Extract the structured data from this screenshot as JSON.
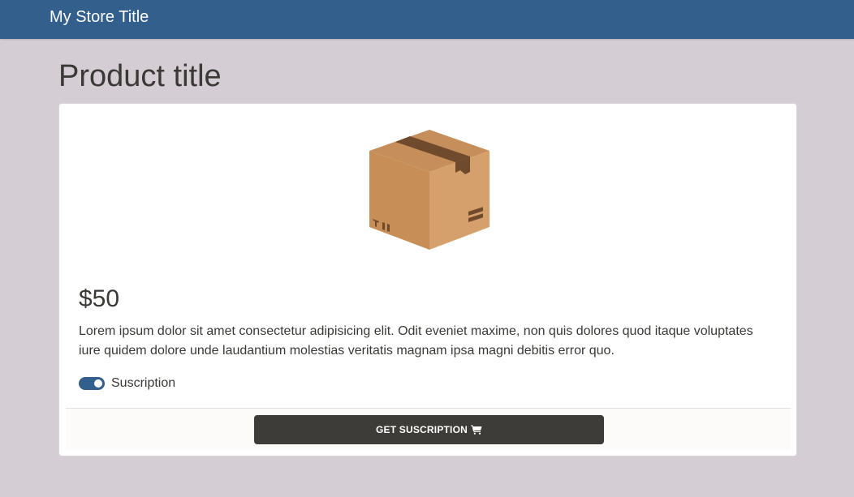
{
  "header": {
    "store_title": "My Store Title"
  },
  "product": {
    "title": "Product title",
    "image_icon": "cardboard-box-icon",
    "price": "$50",
    "description": "Lorem ipsum dolor sit amet consectetur adipisicing elit. Odit eveniet maxime, non quis dolores quod itaque voluptates iure quidem dolore unde laudantium molestias veritatis magnam ipsa magni debitis error quo.",
    "subscription_toggle": {
      "label": "Suscription",
      "checked": true
    },
    "cta": {
      "label": "GET SUSCRIPTION",
      "icon": "shopping-cart-icon"
    }
  },
  "colors": {
    "header_bg": "#325f8b",
    "page_bg": "#d4cdd3",
    "button_bg": "#3d3c38",
    "toggle_on": "#325f8b"
  }
}
